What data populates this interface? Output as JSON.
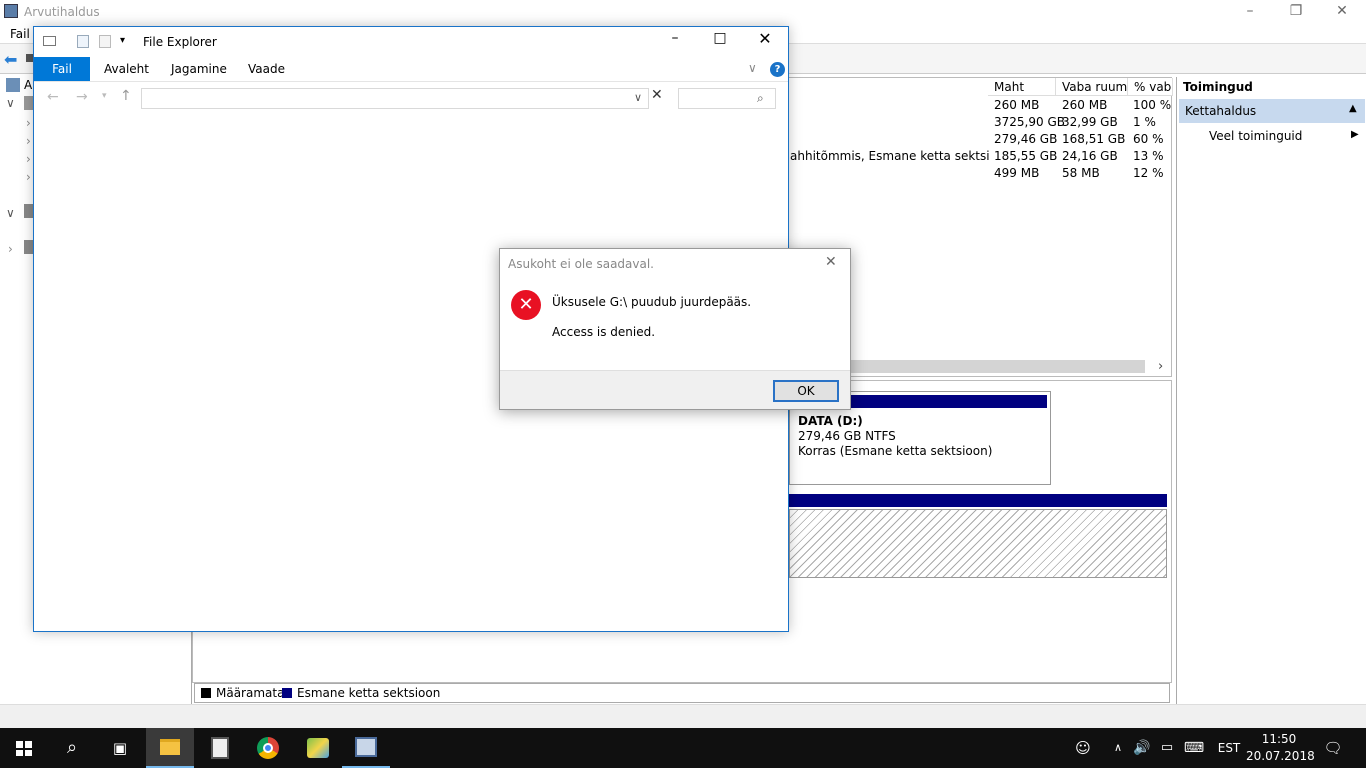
{
  "mmc": {
    "title": "Arvutihaldus",
    "menu_file": "Fail",
    "tree_partial": "A",
    "columns": [
      "Maht",
      "Vaba ruum",
      "% vaba"
    ],
    "rows": [
      {
        "name": "",
        "size": "260 MB",
        "free": "260 MB",
        "pct": "100 %"
      },
      {
        "name": "",
        "size": "3725,90 GB",
        "free": "32,99 GB",
        "pct": "1 %"
      },
      {
        "name": "",
        "size": "279,46 GB",
        "free": "168,51 GB",
        "pct": "60 %"
      },
      {
        "name": "ahhitõmmis, Esmane ketta sektsioon)",
        "size": "185,55 GB",
        "free": "24,16 GB",
        "pct": "13 %"
      },
      {
        "name": "",
        "size": "499 MB",
        "free": "58 MB",
        "pct": "12 %"
      }
    ],
    "disk_d": {
      "title": "DATA  (D:)",
      "line1": "279,46 GB NTFS",
      "line2": "Korras (Esmane ketta sektsioon)"
    },
    "legend": {
      "unallocated": "Määramata",
      "primary": "Esmane ketta sektsioon"
    },
    "actions": {
      "header": "Toimingud",
      "section": "Kettahaldus",
      "more": "Veel toiminguid"
    }
  },
  "explorer": {
    "title": "File Explorer",
    "tabs": [
      "Fail",
      "Avaleht",
      "Jagamine",
      "Vaade"
    ]
  },
  "dialog": {
    "title": "Asukoht ei ole saadaval.",
    "message": "Üksusele G:\\ puudub juurdepääs.",
    "detail": "Access is denied.",
    "ok": "OK"
  },
  "taskbar": {
    "language": "EST",
    "time": "11:50",
    "date": "20.07.2018"
  },
  "colors": {
    "accent": "#0078d7",
    "error": "#e81123",
    "disk_header": "#000080"
  }
}
